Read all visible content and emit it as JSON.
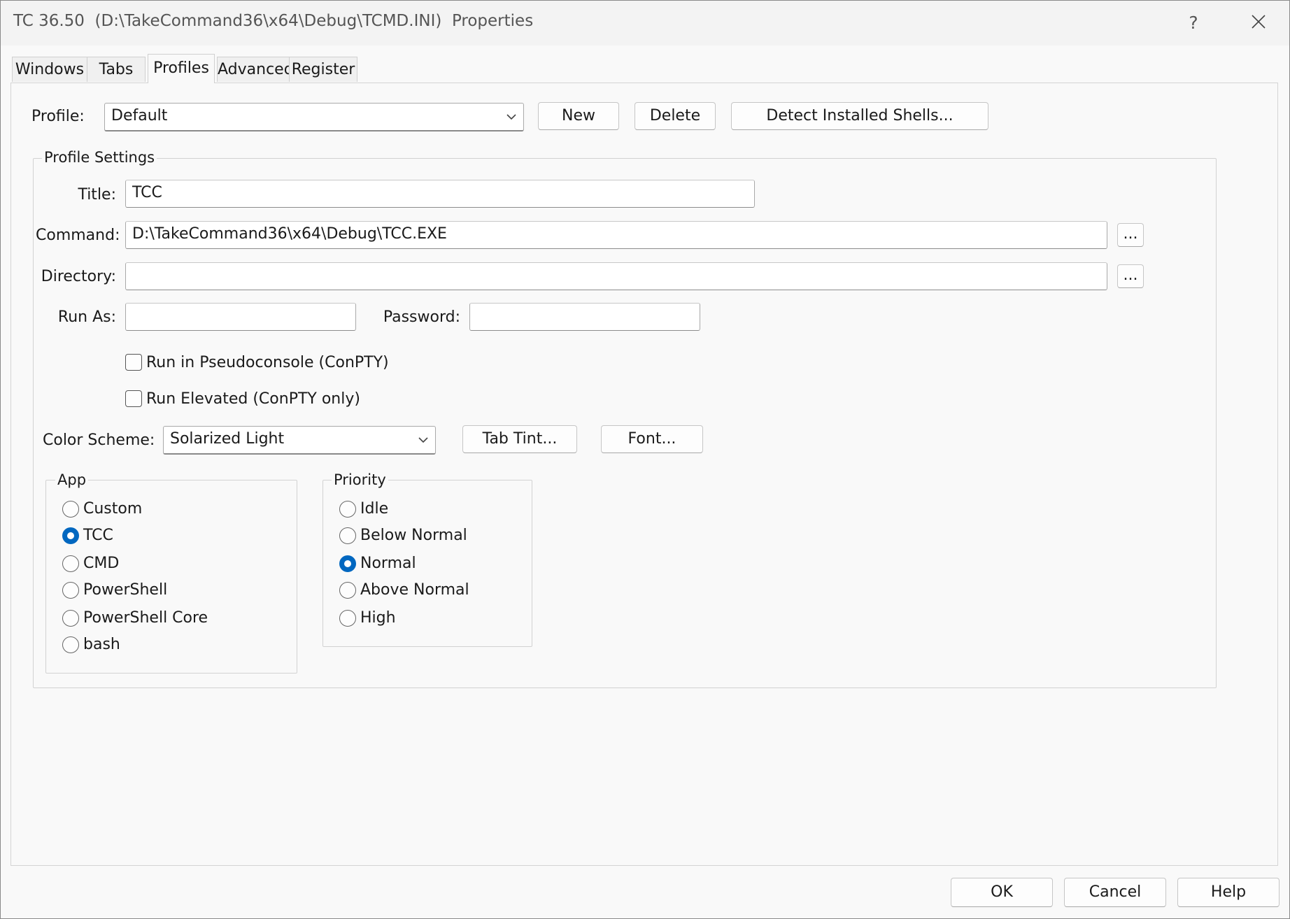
{
  "window": {
    "title": "TC 36.50  (D:\\TakeCommand36\\x64\\Debug\\TCMD.INI)  Properties",
    "help_glyph": "?"
  },
  "tabs": [
    {
      "label": "Windows",
      "active": false
    },
    {
      "label": "Tabs",
      "active": false
    },
    {
      "label": "Profiles",
      "active": true
    },
    {
      "label": "Advanced",
      "active": false
    },
    {
      "label": "Register",
      "active": false
    }
  ],
  "profile": {
    "label": "Profile:",
    "value": "Default",
    "new_label": "New",
    "delete_label": "Delete",
    "detect_label": "Detect Installed Shells..."
  },
  "settings": {
    "group_title": "Profile Settings",
    "title_label": "Title:",
    "title_value": "TCC",
    "command_label": "Command:",
    "command_value": "D:\\TakeCommand36\\x64\\Debug\\TCC.EXE",
    "browse_label": "...",
    "directory_label": "Directory:",
    "directory_value": "",
    "runas_label": "Run As:",
    "runas_value": "",
    "password_label": "Password:",
    "password_value": "",
    "conpty_label": "Run in Pseudoconsole (ConPTY)",
    "conpty_checked": false,
    "elevated_label": "Run Elevated (ConPTY only)",
    "elevated_checked": false,
    "colorscheme_label": "Color Scheme:",
    "colorscheme_value": "Solarized Light",
    "tabtint_label": "Tab Tint...",
    "font_label": "Font..."
  },
  "app": {
    "title": "App",
    "options": [
      "Custom",
      "TCC",
      "CMD",
      "PowerShell",
      "PowerShell Core",
      "bash"
    ],
    "selected": "TCC"
  },
  "priority": {
    "title": "Priority",
    "options": [
      "Idle",
      "Below Normal",
      "Normal",
      "Above Normal",
      "High"
    ],
    "selected": "Normal"
  },
  "footer": {
    "ok_label": "OK",
    "cancel_label": "Cancel",
    "help_label": "Help"
  },
  "colors": {
    "accent": "#0067c0",
    "panel": "#f9f9f9",
    "titlebar": "#f3f3f3"
  }
}
